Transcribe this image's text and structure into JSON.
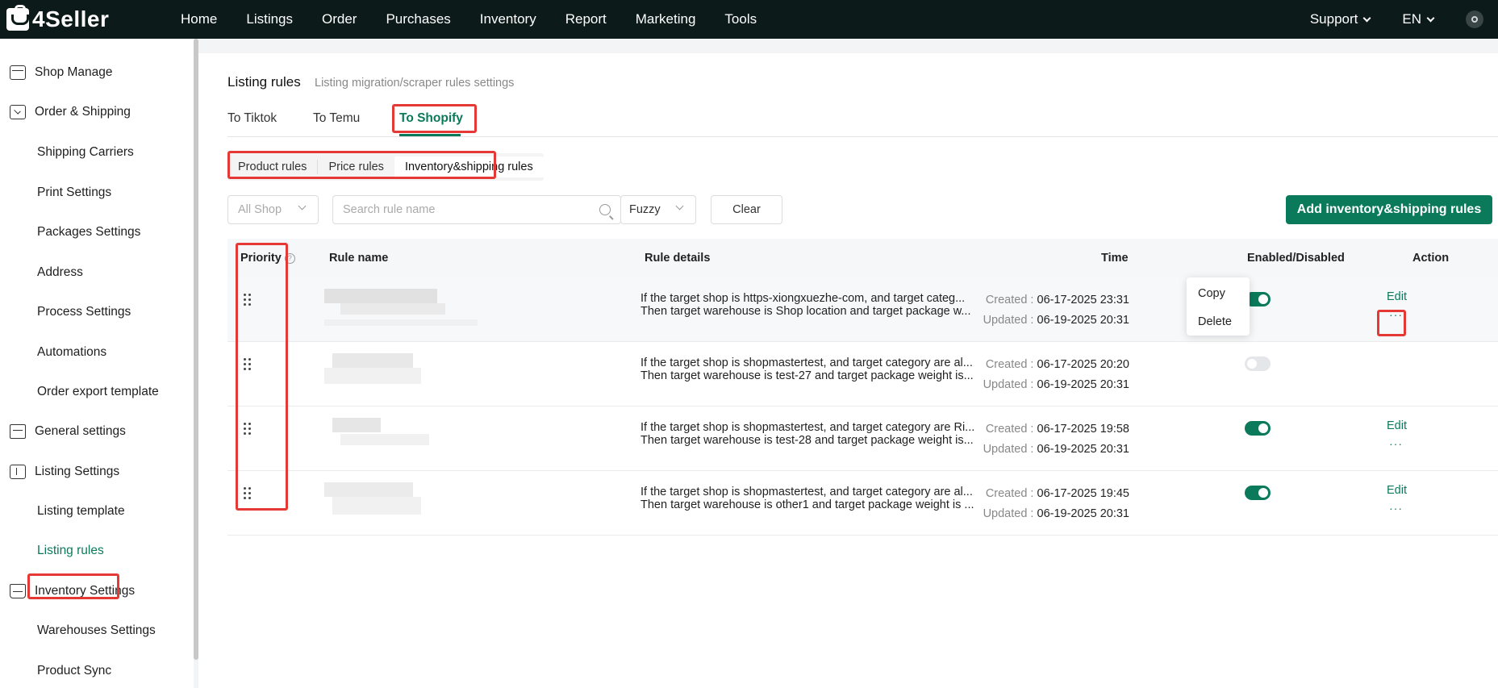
{
  "app": {
    "logo_text": "4Seller"
  },
  "topnav": {
    "items": [
      "Home",
      "Listings",
      "Order",
      "Purchases",
      "Inventory",
      "Report",
      "Marketing",
      "Tools"
    ],
    "support_label": "Support",
    "language_label": "EN"
  },
  "sidebar": {
    "items": [
      {
        "label": "Shop Manage",
        "icon": "shop-icon",
        "type": "group"
      },
      {
        "label": "Order & Shipping",
        "icon": "order-icon",
        "type": "group"
      },
      {
        "label": "Shipping Carriers",
        "type": "sub"
      },
      {
        "label": "Print Settings",
        "type": "sub"
      },
      {
        "label": "Packages Settings",
        "type": "sub"
      },
      {
        "label": "Address",
        "type": "sub"
      },
      {
        "label": "Process Settings",
        "type": "sub"
      },
      {
        "label": "Automations",
        "type": "sub"
      },
      {
        "label": "Order export template",
        "type": "sub"
      },
      {
        "label": "General settings",
        "icon": "general-settings-icon",
        "type": "group"
      },
      {
        "label": "Listing Settings",
        "icon": "listing-settings-icon",
        "type": "group"
      },
      {
        "label": "Listing template",
        "type": "sub"
      },
      {
        "label": "Listing rules",
        "type": "sub",
        "active": true
      },
      {
        "label": "Inventory Settings",
        "icon": "inventory-settings-icon",
        "type": "group"
      },
      {
        "label": "Warehouses Settings",
        "type": "sub"
      },
      {
        "label": "Product Sync",
        "type": "sub"
      }
    ]
  },
  "page": {
    "title": "Listing rules",
    "subtitle": "Listing migration/scraper rules settings",
    "tabs": [
      "To Tiktok",
      "To Temu",
      "To Shopify"
    ],
    "active_tab": "To Shopify",
    "segments": [
      "Product rules",
      "Price rules",
      "Inventory&shipping rules"
    ],
    "active_segment": "Inventory&shipping rules"
  },
  "filters": {
    "shop_placeholder": "All Shop",
    "search_placeholder": "Search rule name",
    "match_mode": "Fuzzy",
    "clear_label": "Clear",
    "add_label": "Add inventory&shipping rules"
  },
  "table": {
    "headers": {
      "priority": "Priority",
      "rule_name": "Rule name",
      "rule_details": "Rule details",
      "time": "Time",
      "enabled": "Enabled/Disabled",
      "action": "Action"
    },
    "created_label": "Created :",
    "updated_label": "Updated :",
    "edit_label": "Edit",
    "more_label": "···",
    "rows": [
      {
        "details_line1": "If the target shop is https-xiongxuezhe-com, and target categ...",
        "details_line2": "Then target warehouse is Shop location and target package w...",
        "created": "06-17-2025 23:31",
        "updated": "06-19-2025 20:31",
        "enabled": true
      },
      {
        "details_line1": "If the target shop is shopmastertest, and target category are al...",
        "details_line2": "Then target warehouse is test-27 and target package weight is...",
        "created": "06-17-2025 20:20",
        "updated": "06-19-2025 20:31",
        "enabled": false
      },
      {
        "details_line1": "If the target shop is shopmastertest, and target category are Ri...",
        "details_line2": "Then target warehouse is test-28 and target package weight is...",
        "created": "06-17-2025 19:58",
        "updated": "06-19-2025 20:31",
        "enabled": true
      },
      {
        "details_line1": "If the target shop is shopmastertest, and target category are al...",
        "details_line2": "Then target warehouse is other1 and target package weight is ...",
        "created": "06-17-2025 19:45",
        "updated": "06-19-2025 20:31",
        "enabled": true
      }
    ]
  },
  "more_menu": {
    "items": [
      "Copy",
      "Delete"
    ]
  },
  "colors": {
    "brand": "#0b7a5b",
    "topbar": "#0c1a1a",
    "highlight": "#e53935"
  }
}
